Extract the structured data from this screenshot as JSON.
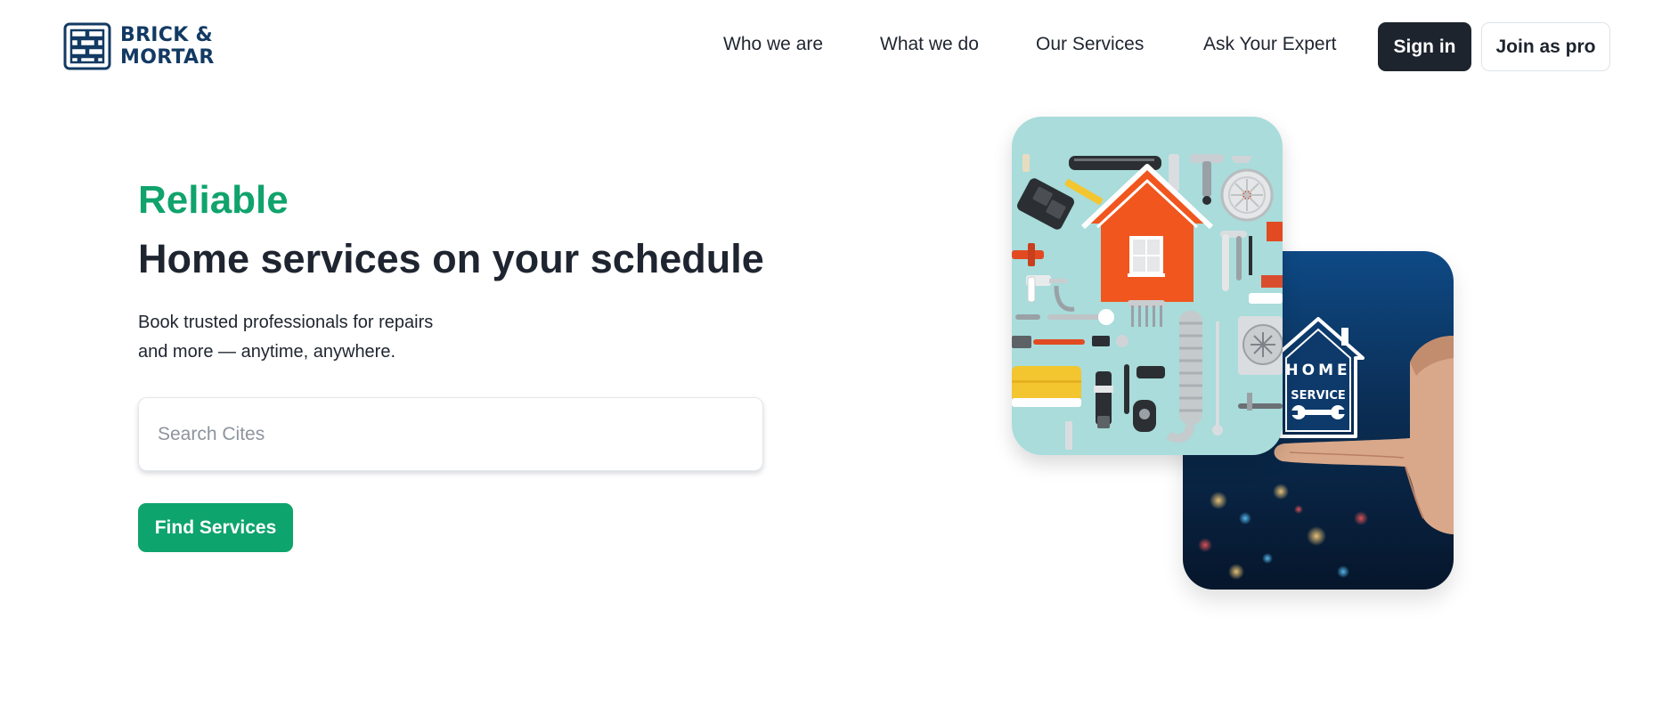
{
  "brand": {
    "line1": "BRICK &",
    "line2": "MORTAR"
  },
  "nav": {
    "items": [
      {
        "label": "Who we are"
      },
      {
        "label": "What we do"
      },
      {
        "label": "Our Services"
      },
      {
        "label": "Ask Your Expert"
      }
    ],
    "signin_label": "Sign in",
    "join_label": "Join as pro"
  },
  "hero": {
    "eyebrow": "Reliable",
    "headline": "Home services on your schedule",
    "subtitle_line1": "Book trusted professionals for repairs",
    "subtitle_line2": "and more — anytime, anywhere.",
    "search_placeholder": "Search Cites",
    "search_value": "",
    "find_label": "Find Services"
  },
  "cards": {
    "back_badge_line1": "HOME",
    "back_badge_line2": "SERVICE"
  },
  "colors": {
    "brand_navy": "#123a63",
    "accent_green": "#10a36c",
    "dark_button": "#1e242d",
    "card_teal": "#a9dcdb",
    "house_orange": "#f0561e",
    "night_blue": "#0d3a6b"
  },
  "icons": {
    "logo": "brick-wall-icon",
    "house": "house-icon",
    "wrench": "wrench-icon"
  }
}
